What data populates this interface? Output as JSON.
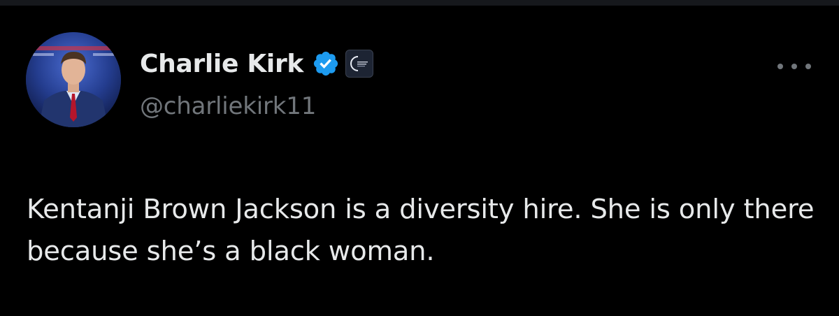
{
  "tweet": {
    "author": {
      "display_name": "Charlie Kirk",
      "handle": "@charliekirk11",
      "avatar_icon": "profile-photo",
      "verified_icon": "verified-badge-icon",
      "verified_color": "#1d9bf0",
      "affiliation_icon": "organization-logo-icon"
    },
    "more_icon": "more-options-icon",
    "text": "Kentanji Brown Jackson is a diversity hire. She is only there because she’s a black woman."
  },
  "colors": {
    "background": "#000000",
    "primary_text": "#e7e9ea",
    "secondary_text": "#71767b"
  }
}
